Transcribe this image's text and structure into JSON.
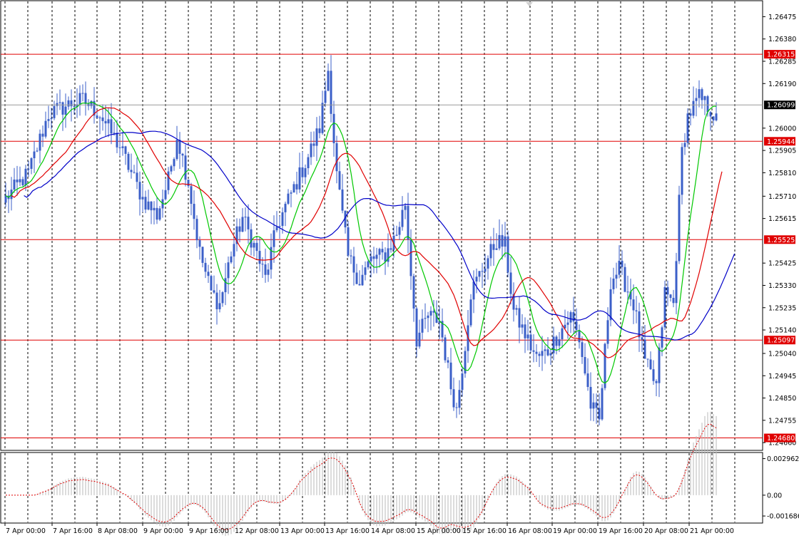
{
  "chart_data": {
    "type": "candlestick",
    "symbol_view": "GBPUSD-style price chart with moving averages and oscillator subwindow",
    "price_axis": {
      "ticks": [
        "1.26475",
        "1.26380",
        "1.26285",
        "1.26190",
        "1.26000",
        "1.25905",
        "1.25810",
        "1.25710",
        "1.25615",
        "1.25425",
        "1.25330",
        "1.25235",
        "1.25140",
        "1.25040",
        "1.24945",
        "1.24850",
        "1.24755",
        "1.24660"
      ],
      "tick_values": [
        1.26475,
        1.2638,
        1.26285,
        1.2619,
        1.26,
        1.25905,
        1.2581,
        1.2571,
        1.25615,
        1.25425,
        1.2533,
        1.25235,
        1.2514,
        1.2504,
        1.24945,
        1.2485,
        1.24755,
        1.2466
      ],
      "ylim": [
        1.2463,
        1.2654
      ]
    },
    "time_axis": {
      "labels": [
        "7 Apr 00:00",
        "7 Apr 16:00",
        "8 Apr 08:00",
        "9 Apr 00:00",
        "9 Apr 16:00",
        "12 Apr 08:00",
        "13 Apr 00:00",
        "13 Apr 16:00",
        "14 Apr 08:00",
        "15 Apr 00:00",
        "15 Apr 16:00",
        "16 Apr 08:00",
        "19 Apr 00:00",
        "19 Apr 16:00",
        "20 Apr 08:00",
        "21 Apr 00:00"
      ]
    },
    "horizontal_levels": [
      {
        "value": 1.26315,
        "label": "1.26315"
      },
      {
        "value": 1.25944,
        "label": "1.25944"
      },
      {
        "value": 1.25525,
        "label": "1.25525"
      },
      {
        "value": 1.25097,
        "label": "1.25097"
      },
      {
        "value": 1.2468,
        "label": "1.24680"
      }
    ],
    "current_price": {
      "value": 1.26099,
      "label": "1.26099"
    },
    "bar_count": 250,
    "price_anchors": [
      [
        0,
        1.257
      ],
      [
        8,
        1.2581
      ],
      [
        15,
        1.2606
      ],
      [
        22,
        1.261
      ],
      [
        27,
        1.2612
      ],
      [
        33,
        1.2606
      ],
      [
        40,
        1.2592
      ],
      [
        48,
        1.257
      ],
      [
        53,
        1.2563
      ],
      [
        57,
        1.2578
      ],
      [
        60,
        1.2597
      ],
      [
        64,
        1.2577
      ],
      [
        68,
        1.2547
      ],
      [
        72,
        1.253
      ],
      [
        75,
        1.2525
      ],
      [
        79,
        1.2547
      ],
      [
        83,
        1.2562
      ],
      [
        87,
        1.255
      ],
      [
        91,
        1.2536
      ],
      [
        95,
        1.2558
      ],
      [
        100,
        1.2572
      ],
      [
        105,
        1.2585
      ],
      [
        110,
        1.26
      ],
      [
        113,
        1.2625
      ],
      [
        116,
        1.258
      ],
      [
        120,
        1.2545
      ],
      [
        124,
        1.2535
      ],
      [
        128,
        1.2544
      ],
      [
        133,
        1.2546
      ],
      [
        137,
        1.2555
      ],
      [
        140,
        1.2568
      ],
      [
        144,
        1.251
      ],
      [
        148,
        1.252
      ],
      [
        152,
        1.2518
      ],
      [
        156,
        1.249
      ],
      [
        158,
        1.248
      ],
      [
        161,
        1.2508
      ],
      [
        163,
        1.253
      ],
      [
        167,
        1.254
      ],
      [
        172,
        1.2552
      ],
      [
        175,
        1.255
      ],
      [
        178,
        1.2522
      ],
      [
        182,
        1.2512
      ],
      [
        186,
        1.2502
      ],
      [
        190,
        1.2505
      ],
      [
        194,
        1.2513
      ],
      [
        198,
        1.252
      ],
      [
        201,
        1.251
      ],
      [
        205,
        1.2482
      ],
      [
        208,
        1.2475
      ],
      [
        212,
        1.2535
      ],
      [
        215,
        1.254
      ],
      [
        220,
        1.2525
      ],
      [
        224,
        1.25
      ],
      [
        228,
        1.249
      ],
      [
        231,
        1.253
      ],
      [
        234,
        1.2525
      ],
      [
        237,
        1.259
      ],
      [
        239,
        1.2605
      ],
      [
        243,
        1.2613
      ],
      [
        247,
        1.2608
      ],
      [
        249,
        1.2603
      ]
    ],
    "moving_averages": [
      {
        "color": "#00c800",
        "period": 5
      },
      {
        "color": "#e00000",
        "period": 10
      },
      {
        "color": "#0000c8",
        "period": 21
      }
    ],
    "oscillator": {
      "ticks": [
        "0.002962",
        "0.00",
        "-0.001686"
      ],
      "tick_values": [
        0.002962,
        0.0,
        -0.001686
      ],
      "ylim": [
        -0.0022,
        0.0034
      ]
    },
    "colors": {
      "candle": "#3b5fc8",
      "level_line": "#e00000",
      "level_label_bg": "#e00000",
      "current_label_bg": "#000000",
      "grid": "#000000",
      "osc_hist": "#b8b8b8",
      "osc_signal": "#e00000"
    }
  }
}
